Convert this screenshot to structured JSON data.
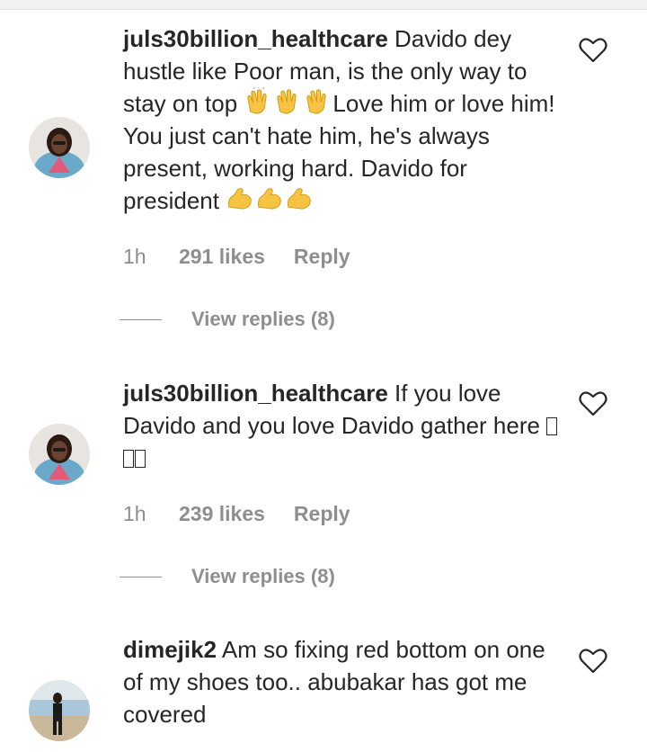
{
  "comments": [
    {
      "username": "juls30billion_healthcare",
      "text_parts": [
        " Davido dey hustle like Poor man, is the only way to stay on top ",
        "Love him or love him! You just can't hate him, he's always present, working hard. Davido for president "
      ],
      "time": "1h",
      "likes": "291 likes",
      "reply": "Reply",
      "view_replies": "View replies (8)"
    },
    {
      "username": "juls30billion_healthcare",
      "text_parts": [
        " If you love Davido and you love Davido gather here "
      ],
      "time": "1h",
      "likes": "239 likes",
      "reply": "Reply",
      "view_replies": "View replies (8)"
    },
    {
      "username": "dimejik2",
      "text_parts": [
        " Am so fixing red bottom on one of my shoes too.. abubakar has got me covered"
      ]
    }
  ],
  "icons": {
    "like": "heart-outline-icon",
    "clap": "clapping-hands-emoji",
    "flex": "flexed-biceps-emoji",
    "missing": "missing-glyph-box"
  },
  "colors": {
    "text": "#262626",
    "secondary": "#8e8e8e"
  }
}
